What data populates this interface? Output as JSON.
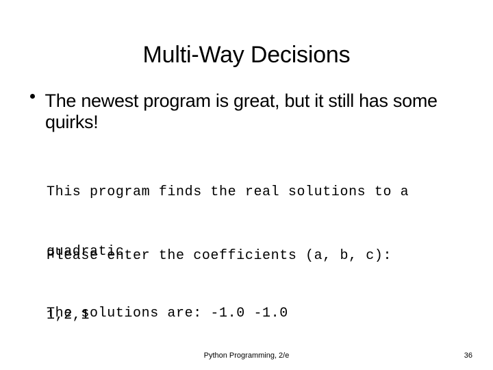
{
  "slide": {
    "title": "Multi-Way Decisions",
    "background_color": "#ffffff",
    "text_color": "#000000",
    "bullets": [
      {
        "marker": "bullet-dot",
        "text": "The newest program is great, but it still has some quirks!"
      }
    ],
    "console_blocks": [
      {
        "lines": [
          "This program finds the real solutions to a",
          "quadratic"
        ]
      },
      {
        "lines": [
          "Please enter the coefficients (a, b, c):",
          "1,2,1"
        ]
      },
      {
        "lines": [
          "The solutions are: -1.0 -1.0"
        ]
      }
    ],
    "footer": {
      "credit": "Python Programming, 2/e",
      "page_number": "36"
    }
  }
}
